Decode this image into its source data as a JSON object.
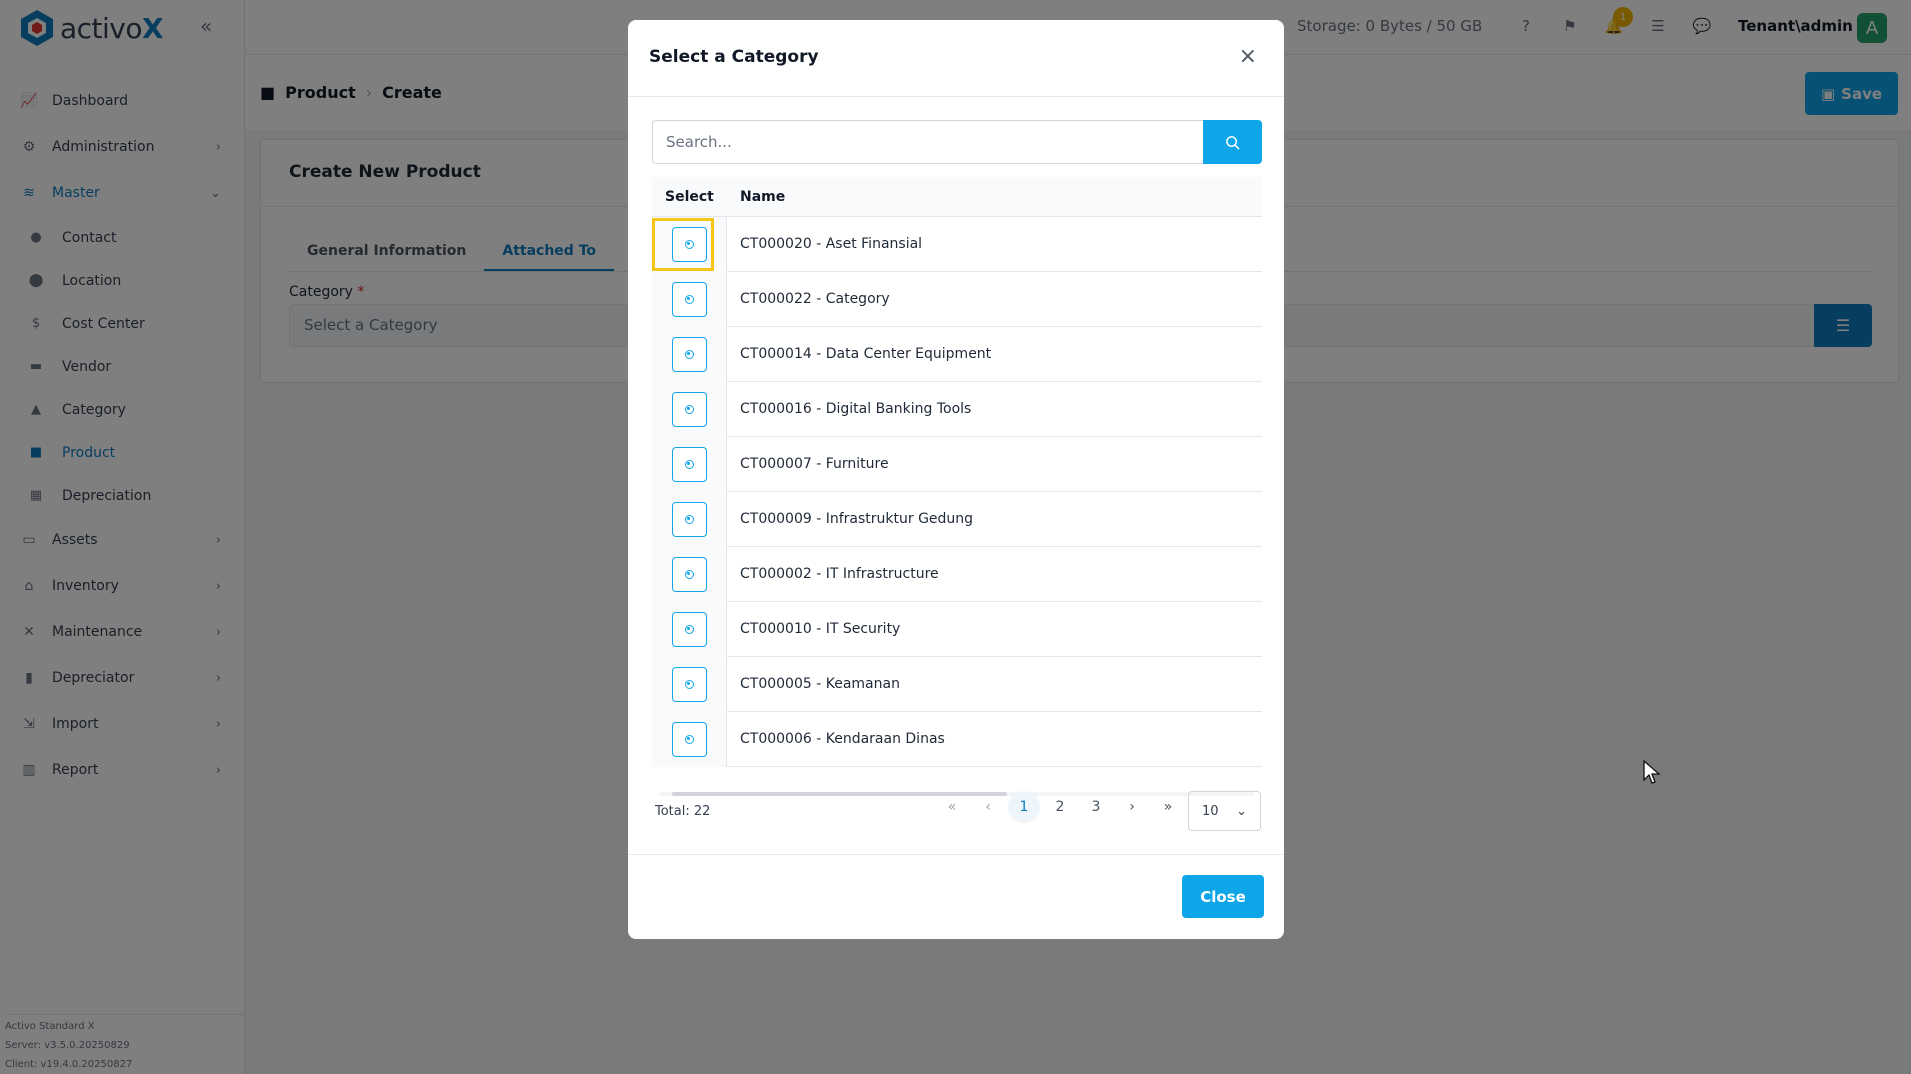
{
  "app": {
    "logo_text": "activo",
    "logo_accent": "X"
  },
  "sidebar": {
    "items": [
      {
        "label": "Dashboard",
        "icon": "chart-line-icon"
      },
      {
        "label": "Administration",
        "icon": "gears-icon"
      },
      {
        "label": "Master",
        "icon": "database-icon"
      },
      {
        "label": "Assets",
        "icon": "laptop-icon"
      },
      {
        "label": "Inventory",
        "icon": "warehouse-icon"
      },
      {
        "label": "Maintenance",
        "icon": "tools-icon"
      },
      {
        "label": "Depreciator",
        "icon": "clipboard-icon"
      },
      {
        "label": "Import",
        "icon": "file-import-icon"
      },
      {
        "label": "Report",
        "icon": "chart-bar-icon"
      }
    ],
    "master_sub": [
      {
        "label": "Contact",
        "icon": "user-icon"
      },
      {
        "label": "Location",
        "icon": "map-pin-icon"
      },
      {
        "label": "Cost Center",
        "icon": "dollar-icon"
      },
      {
        "label": "Vendor",
        "icon": "store-icon"
      },
      {
        "label": "Category",
        "icon": "shapes-icon"
      },
      {
        "label": "Product",
        "icon": "box-icon"
      },
      {
        "label": "Depreciation",
        "icon": "calculator-icon"
      }
    ],
    "version": {
      "product": "Activo Standard X",
      "server": "Server: v3.5.0.20250829",
      "client": "Client: v19.4.0.20250827"
    }
  },
  "topbar": {
    "storage": "Storage: 0 Bytes / 50 GB",
    "notification_count": "1",
    "user": "Tenant\\admin",
    "avatar_letter": "A"
  },
  "page": {
    "breadcrumb": [
      "Product",
      "Create"
    ],
    "save_label": "Save",
    "card_title": "Create New Product",
    "tabs": [
      "General Information",
      "Attached To"
    ],
    "category_label": "Category",
    "category_required": "*",
    "category_placeholder": "Select a Category"
  },
  "modal": {
    "title": "Select a Category",
    "search_placeholder": "Search...",
    "columns": [
      "Select",
      "Name"
    ],
    "rows": [
      "CT000020 - Aset Finansial",
      "CT000022 - Category",
      "CT000014 - Data Center Equipment",
      "CT000016 - Digital Banking Tools",
      "CT000007 - Furniture",
      "CT000009 - Infrastruktur Gedung",
      "CT000002 - IT Infrastructure",
      "CT000010 - IT Security",
      "CT000005 - Keamanan",
      "CT000006 - Kendaraan Dinas"
    ],
    "total": "Total: 22",
    "pages": [
      "1",
      "2",
      "3"
    ],
    "current_page": "1",
    "page_size": "10",
    "close_label": "Close"
  },
  "colors": {
    "accent": "#0ea5e9",
    "brand": "#0e7cc0",
    "highlight": "#f5c518"
  }
}
